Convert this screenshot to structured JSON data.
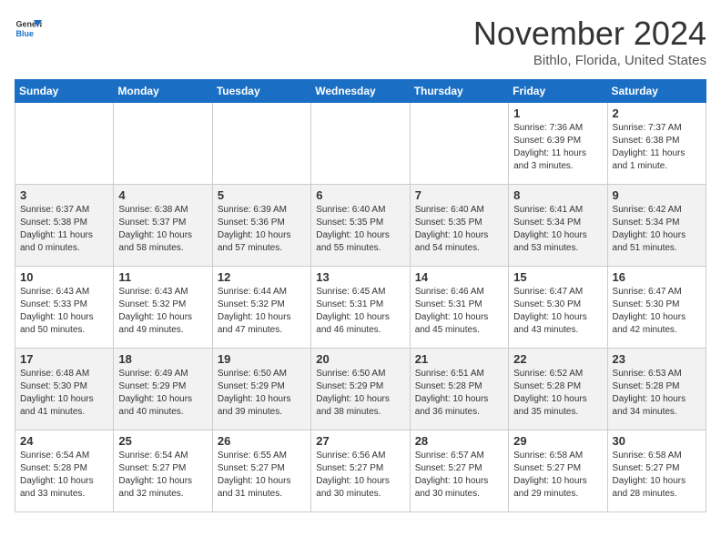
{
  "header": {
    "logo_general": "General",
    "logo_blue": "Blue",
    "month": "November 2024",
    "location": "Bithlo, Florida, United States"
  },
  "weekdays": [
    "Sunday",
    "Monday",
    "Tuesday",
    "Wednesday",
    "Thursday",
    "Friday",
    "Saturday"
  ],
  "weeks": [
    [
      {
        "day": "",
        "info": ""
      },
      {
        "day": "",
        "info": ""
      },
      {
        "day": "",
        "info": ""
      },
      {
        "day": "",
        "info": ""
      },
      {
        "day": "",
        "info": ""
      },
      {
        "day": "1",
        "info": "Sunrise: 7:36 AM\nSunset: 6:39 PM\nDaylight: 11 hours\nand 3 minutes."
      },
      {
        "day": "2",
        "info": "Sunrise: 7:37 AM\nSunset: 6:38 PM\nDaylight: 11 hours\nand 1 minute."
      }
    ],
    [
      {
        "day": "3",
        "info": "Sunrise: 6:37 AM\nSunset: 5:38 PM\nDaylight: 11 hours\nand 0 minutes."
      },
      {
        "day": "4",
        "info": "Sunrise: 6:38 AM\nSunset: 5:37 PM\nDaylight: 10 hours\nand 58 minutes."
      },
      {
        "day": "5",
        "info": "Sunrise: 6:39 AM\nSunset: 5:36 PM\nDaylight: 10 hours\nand 57 minutes."
      },
      {
        "day": "6",
        "info": "Sunrise: 6:40 AM\nSunset: 5:35 PM\nDaylight: 10 hours\nand 55 minutes."
      },
      {
        "day": "7",
        "info": "Sunrise: 6:40 AM\nSunset: 5:35 PM\nDaylight: 10 hours\nand 54 minutes."
      },
      {
        "day": "8",
        "info": "Sunrise: 6:41 AM\nSunset: 5:34 PM\nDaylight: 10 hours\nand 53 minutes."
      },
      {
        "day": "9",
        "info": "Sunrise: 6:42 AM\nSunset: 5:34 PM\nDaylight: 10 hours\nand 51 minutes."
      }
    ],
    [
      {
        "day": "10",
        "info": "Sunrise: 6:43 AM\nSunset: 5:33 PM\nDaylight: 10 hours\nand 50 minutes."
      },
      {
        "day": "11",
        "info": "Sunrise: 6:43 AM\nSunset: 5:32 PM\nDaylight: 10 hours\nand 49 minutes."
      },
      {
        "day": "12",
        "info": "Sunrise: 6:44 AM\nSunset: 5:32 PM\nDaylight: 10 hours\nand 47 minutes."
      },
      {
        "day": "13",
        "info": "Sunrise: 6:45 AM\nSunset: 5:31 PM\nDaylight: 10 hours\nand 46 minutes."
      },
      {
        "day": "14",
        "info": "Sunrise: 6:46 AM\nSunset: 5:31 PM\nDaylight: 10 hours\nand 45 minutes."
      },
      {
        "day": "15",
        "info": "Sunrise: 6:47 AM\nSunset: 5:30 PM\nDaylight: 10 hours\nand 43 minutes."
      },
      {
        "day": "16",
        "info": "Sunrise: 6:47 AM\nSunset: 5:30 PM\nDaylight: 10 hours\nand 42 minutes."
      }
    ],
    [
      {
        "day": "17",
        "info": "Sunrise: 6:48 AM\nSunset: 5:30 PM\nDaylight: 10 hours\nand 41 minutes."
      },
      {
        "day": "18",
        "info": "Sunrise: 6:49 AM\nSunset: 5:29 PM\nDaylight: 10 hours\nand 40 minutes."
      },
      {
        "day": "19",
        "info": "Sunrise: 6:50 AM\nSunset: 5:29 PM\nDaylight: 10 hours\nand 39 minutes."
      },
      {
        "day": "20",
        "info": "Sunrise: 6:50 AM\nSunset: 5:29 PM\nDaylight: 10 hours\nand 38 minutes."
      },
      {
        "day": "21",
        "info": "Sunrise: 6:51 AM\nSunset: 5:28 PM\nDaylight: 10 hours\nand 36 minutes."
      },
      {
        "day": "22",
        "info": "Sunrise: 6:52 AM\nSunset: 5:28 PM\nDaylight: 10 hours\nand 35 minutes."
      },
      {
        "day": "23",
        "info": "Sunrise: 6:53 AM\nSunset: 5:28 PM\nDaylight: 10 hours\nand 34 minutes."
      }
    ],
    [
      {
        "day": "24",
        "info": "Sunrise: 6:54 AM\nSunset: 5:28 PM\nDaylight: 10 hours\nand 33 minutes."
      },
      {
        "day": "25",
        "info": "Sunrise: 6:54 AM\nSunset: 5:27 PM\nDaylight: 10 hours\nand 32 minutes."
      },
      {
        "day": "26",
        "info": "Sunrise: 6:55 AM\nSunset: 5:27 PM\nDaylight: 10 hours\nand 31 minutes."
      },
      {
        "day": "27",
        "info": "Sunrise: 6:56 AM\nSunset: 5:27 PM\nDaylight: 10 hours\nand 30 minutes."
      },
      {
        "day": "28",
        "info": "Sunrise: 6:57 AM\nSunset: 5:27 PM\nDaylight: 10 hours\nand 30 minutes."
      },
      {
        "day": "29",
        "info": "Sunrise: 6:58 AM\nSunset: 5:27 PM\nDaylight: 10 hours\nand 29 minutes."
      },
      {
        "day": "30",
        "info": "Sunrise: 6:58 AM\nSunset: 5:27 PM\nDaylight: 10 hours\nand 28 minutes."
      }
    ]
  ]
}
